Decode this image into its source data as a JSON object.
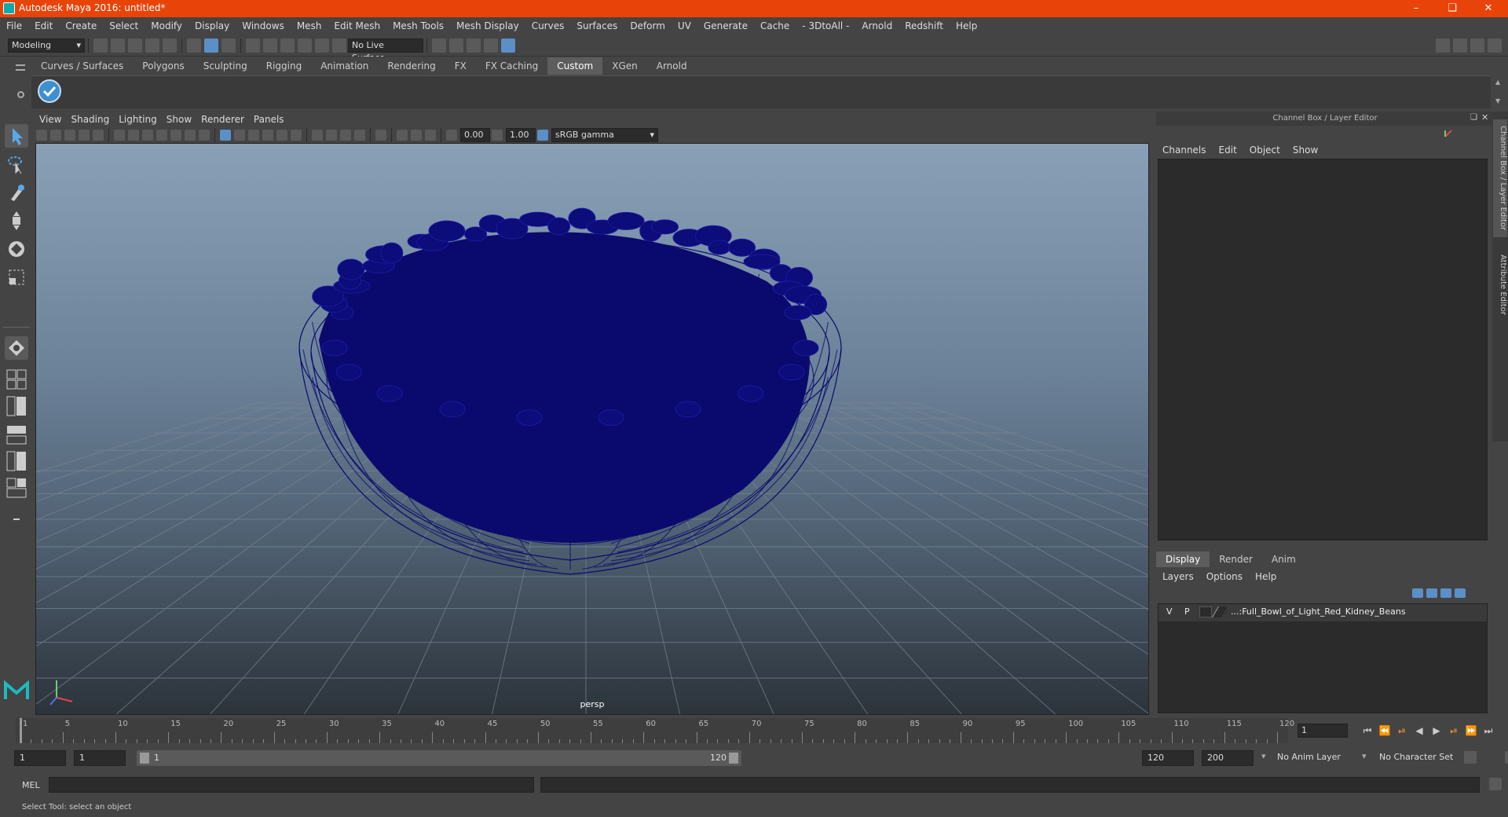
{
  "window": {
    "title": "Autodesk Maya 2016: untitled*"
  },
  "menu": [
    "File",
    "Edit",
    "Create",
    "Select",
    "Modify",
    "Display",
    "Windows",
    "Mesh",
    "Edit Mesh",
    "Mesh Tools",
    "Mesh Display",
    "Curves",
    "Surfaces",
    "Deform",
    "UV",
    "Generate",
    "Cache",
    "- 3DtoAll -",
    "Arnold",
    "Redshift",
    "Help"
  ],
  "status": {
    "mode": "Modeling",
    "live_surface": "No Live Surface"
  },
  "shelf": {
    "tabs": [
      "Curves / Surfaces",
      "Polygons",
      "Sculpting",
      "Rigging",
      "Animation",
      "Rendering",
      "FX",
      "FX Caching",
      "Custom",
      "XGen",
      "Arnold"
    ],
    "active": "Custom"
  },
  "viewport": {
    "menu": [
      "View",
      "Shading",
      "Lighting",
      "Show",
      "Renderer",
      "Panels"
    ],
    "exposure": "0.00",
    "gamma": "1.00",
    "colorspace": "sRGB gamma",
    "camera": "persp"
  },
  "channelbox": {
    "header": "Channel Box / Layer Editor",
    "menu": [
      "Channels",
      "Edit",
      "Object",
      "Show"
    ]
  },
  "sidetabs": [
    "Channel Box / Layer Editor",
    "Attribute Editor"
  ],
  "layereditor": {
    "tabs": [
      "Display",
      "Render",
      "Anim"
    ],
    "active": "Display",
    "menu": [
      "Layers",
      "Options",
      "Help"
    ],
    "layer": {
      "v": "V",
      "p": "P",
      "name": "...:Full_Bowl_of_Light_Red_Kidney_Beans"
    }
  },
  "timeline": {
    "ticks": [
      "1",
      "5",
      "10",
      "15",
      "20",
      "25",
      "30",
      "35",
      "40",
      "45",
      "50",
      "55",
      "60",
      "65",
      "70",
      "75",
      "80",
      "85",
      "90",
      "95",
      "100",
      "105",
      "110",
      "115",
      "120"
    ],
    "current_frame": "1"
  },
  "range": {
    "start": "1",
    "playback_start": "1",
    "slider_start": "1",
    "slider_end": "120",
    "playback_end": "120",
    "end": "200",
    "anim_layer": "No Anim Layer",
    "character_set": "No Character Set"
  },
  "cmd": {
    "label": "MEL"
  },
  "help": {
    "text": "Select Tool: select an object"
  },
  "colors": {
    "title_bar": "#e8440a",
    "wireframe": "#0a0a6e",
    "accent": "#5a8fc8"
  }
}
